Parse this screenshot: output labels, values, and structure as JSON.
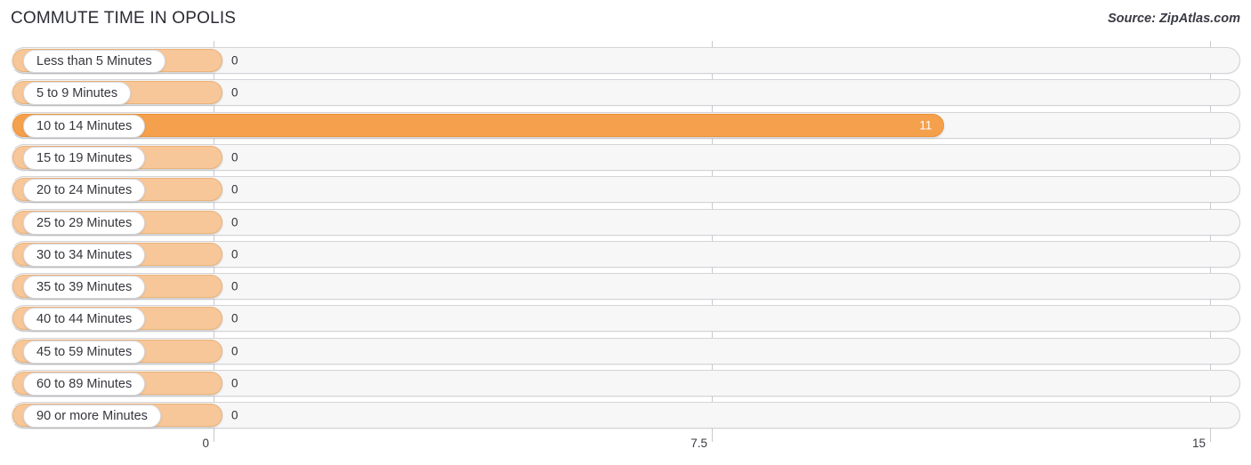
{
  "header": {
    "title": "COMMUTE TIME IN OPOLIS",
    "source": "Source: ZipAtlas.com"
  },
  "colors": {
    "bar_zero": "#F7C79A",
    "bar_highlight": "#F5A04C",
    "track": "#F7F7F8",
    "gridline": "#C9C9CF",
    "label_text": "#36363D"
  },
  "chart_data": {
    "type": "bar",
    "orientation": "horizontal",
    "title": "COMMUTE TIME IN OPOLIS",
    "xlabel": "",
    "ylabel": "",
    "xlim": [
      0,
      15
    ],
    "grid": true,
    "legend": "none",
    "ticks": [
      {
        "label": "0",
        "value": 0
      },
      {
        "label": "7.5",
        "value": 7.5
      },
      {
        "label": "15",
        "value": 15
      }
    ],
    "categories": [
      "Less than 5 Minutes",
      "5 to 9 Minutes",
      "10 to 14 Minutes",
      "15 to 19 Minutes",
      "20 to 24 Minutes",
      "25 to 29 Minutes",
      "30 to 34 Minutes",
      "35 to 39 Minutes",
      "40 to 44 Minutes",
      "45 to 59 Minutes",
      "60 to 89 Minutes",
      "90 or more Minutes"
    ],
    "values": [
      0,
      0,
      11,
      0,
      0,
      0,
      0,
      0,
      0,
      0,
      0,
      0
    ],
    "value_labels": [
      "0",
      "0",
      "11",
      "0",
      "0",
      "0",
      "0",
      "0",
      "0",
      "0",
      "0",
      "0"
    ]
  }
}
